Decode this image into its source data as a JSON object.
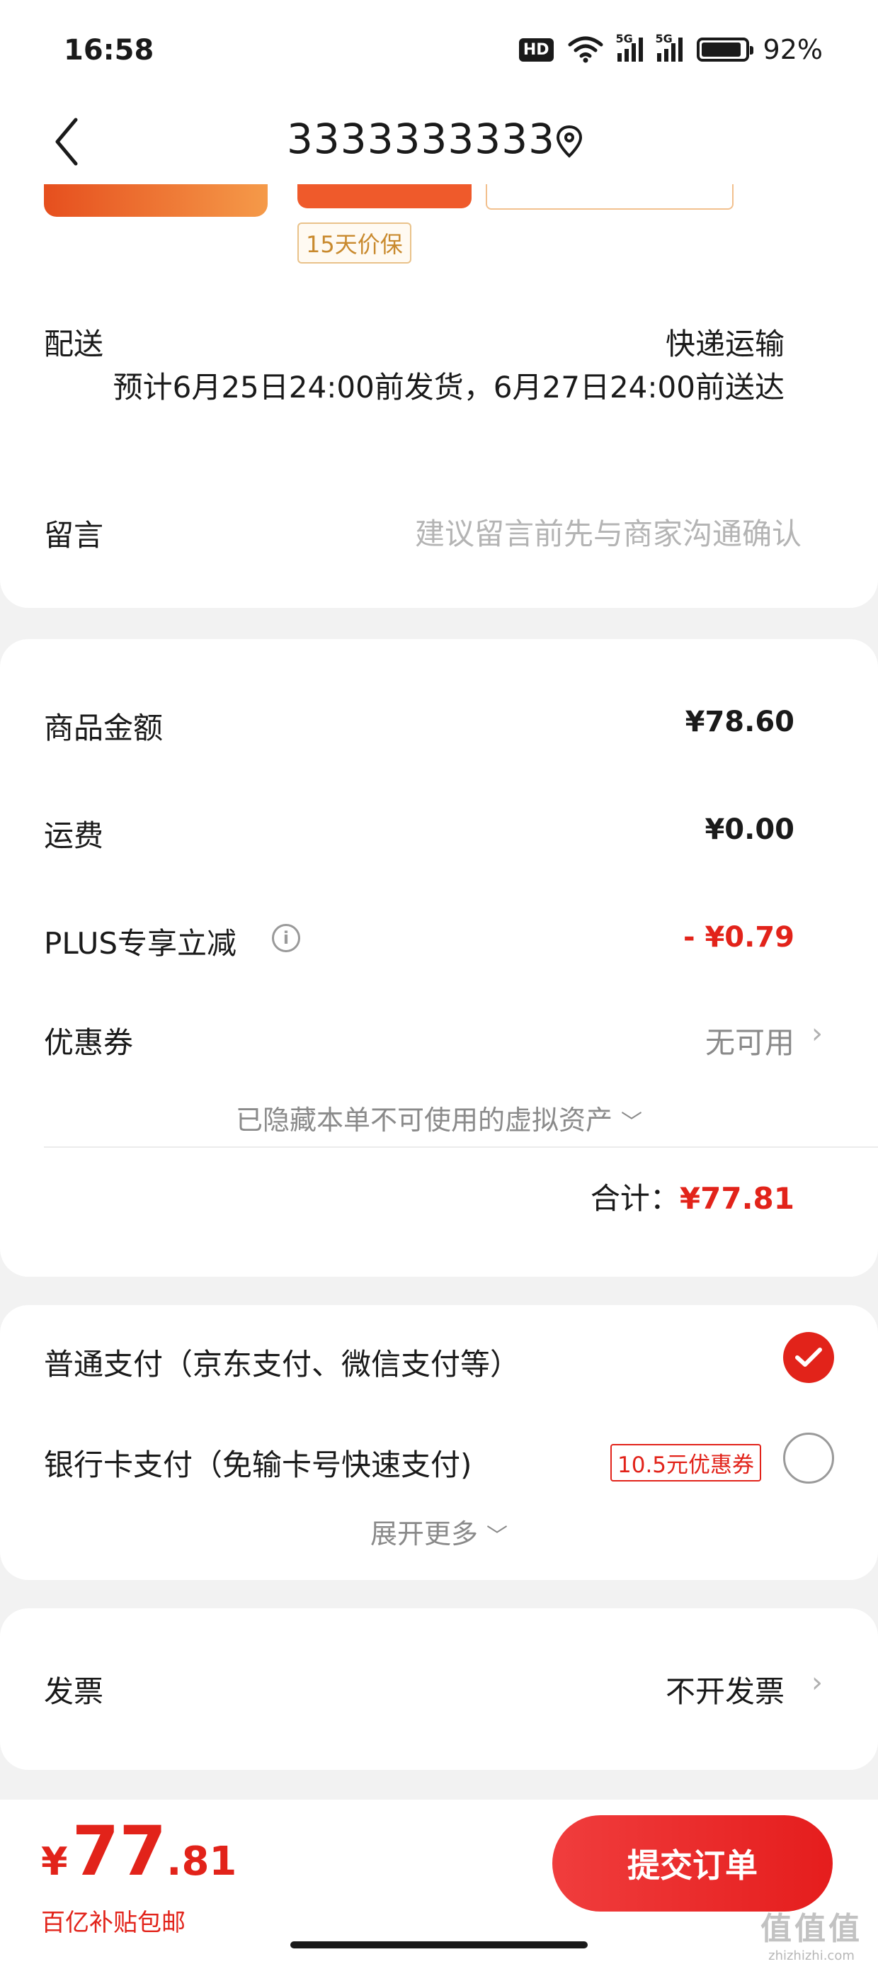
{
  "status_bar": {
    "time": "16:58",
    "hd_badge": "HD",
    "signal_label": "5G",
    "battery_percent": "92%",
    "battery_level": 0.92
  },
  "header": {
    "title": "3333333333",
    "back_icon": "chevron-left-icon",
    "location_icon": "map-pin-icon"
  },
  "product": {
    "price_protection_tag": "15天价保"
  },
  "delivery": {
    "label": "配送",
    "method": "快递运输",
    "estimate": "预计6月25日24:00前发货，6月27日24:00前送达"
  },
  "memo": {
    "label": "留言",
    "placeholder": "建议留言前先与商家沟通确认"
  },
  "amounts": {
    "goods_label": "商品金额",
    "goods_value": "¥78.60",
    "shipping_label": "运费",
    "shipping_value": "¥0.00",
    "plus_label": "PLUS专享立减",
    "plus_value": "- ¥0.79",
    "coupon_label": "优惠券",
    "coupon_value": "无可用",
    "hidden_assets": "已隐藏本单不可使用的虚拟资产",
    "total_label": "合计：",
    "total_value": "¥77.81"
  },
  "payment": {
    "option1_label": "普通支付（京东支付、微信支付等）",
    "option1_selected": true,
    "option2_label": "银行卡支付（免输卡号快速支付)",
    "option2_badge": "10.5元优惠券",
    "option2_selected": false,
    "expand_more": "展开更多"
  },
  "invoice": {
    "label": "发票",
    "value": "不开发票"
  },
  "bottom": {
    "currency": "¥",
    "price_int": "77",
    "price_dec": ".81",
    "subsidy_text": "百亿补贴包邮",
    "submit_label": "提交订单"
  },
  "watermark": {
    "main": "值值值",
    "sub": "zhizhizhi.com"
  },
  "colors": {
    "accent_red": "#e2231a",
    "background": "#f2f2f2",
    "muted_text": "#8a8a8a"
  }
}
